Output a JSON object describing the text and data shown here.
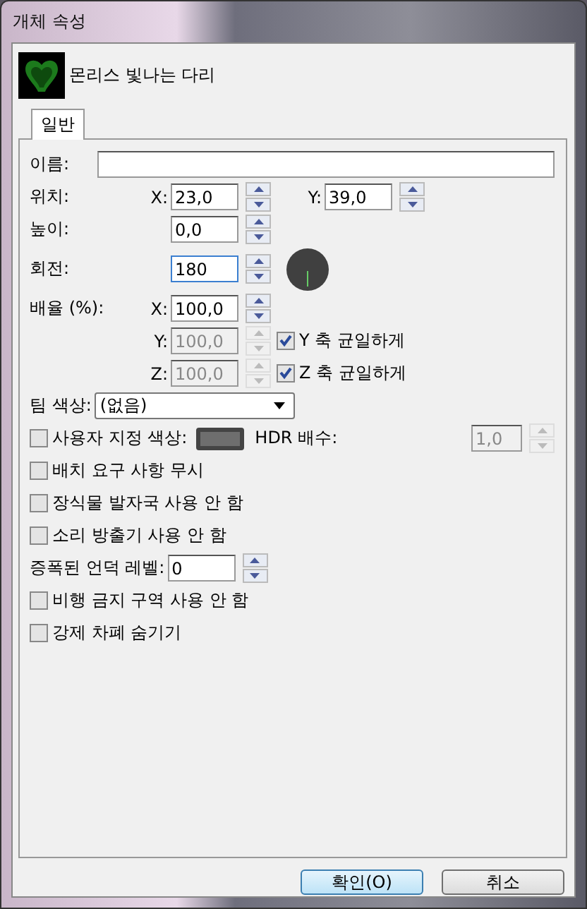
{
  "window": {
    "title": "개체 속성"
  },
  "object": {
    "name": "몬리스 빛나는 다리"
  },
  "tabs": [
    {
      "label": "일반",
      "selected": true
    }
  ],
  "name_field": {
    "label": "이름:"
  },
  "position": {
    "label": "위치:",
    "x_label": "X:",
    "x_value": "23,0",
    "y_label": "Y:",
    "y_value": "39,0"
  },
  "height": {
    "label": "높이:",
    "value": "0,0"
  },
  "rotation": {
    "label": "회전:",
    "value": "180",
    "focused": true
  },
  "scale": {
    "label": "배율 (%):",
    "rows": [
      {
        "axis": "X:",
        "value": "100,0",
        "disabled": false
      },
      {
        "axis": "Y:",
        "value": "100,0",
        "disabled": true,
        "uniform_label": "Y 축 균일하게",
        "uniform_checked": true
      },
      {
        "axis": "Z:",
        "value": "100,0",
        "disabled": true,
        "uniform_label": "Z 축 균일하게",
        "uniform_checked": true
      }
    ]
  },
  "team_color": {
    "label": "팀 색상:",
    "value": "(없음)"
  },
  "custom_color": {
    "label": "사용자 지정 색상:",
    "checked": false,
    "hdr_label": "HDR 배수:",
    "hdr_value": "1,0",
    "hdr_disabled": true
  },
  "options_a": [
    {
      "label": "배치 요구 사항 무시",
      "checked": false
    },
    {
      "label": "장식물 발자국 사용 안 함",
      "checked": false
    },
    {
      "label": "소리 방출기 사용 안 함",
      "checked": false
    }
  ],
  "hill_level": {
    "label": "증폭된 언덕 레벨:",
    "value": "0"
  },
  "options_b": [
    {
      "label": "비행 금지 구역 사용 안 함",
      "checked": false
    },
    {
      "label": "강제 차폐 숨기기",
      "checked": false
    }
  ],
  "buttons": [
    {
      "label": "확인(O)",
      "default": true
    },
    {
      "label": "취소",
      "default": false
    }
  ]
}
